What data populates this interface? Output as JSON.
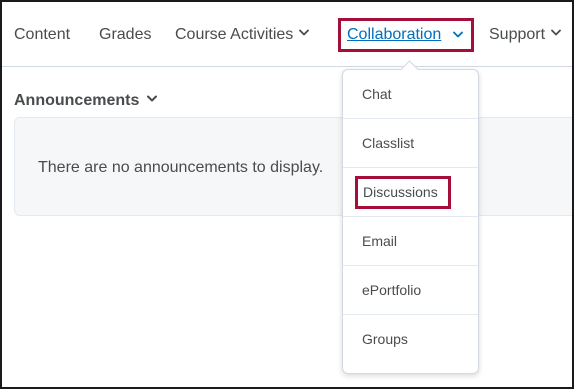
{
  "navbar": {
    "items": [
      {
        "label": "Content"
      },
      {
        "label": "Grades"
      },
      {
        "label": "Course Activities"
      },
      {
        "label": "Collaboration"
      },
      {
        "label": "Support"
      }
    ]
  },
  "widget": {
    "title": "Announcements",
    "message": "There are no announcements to display."
  },
  "dropdown": {
    "items": [
      {
        "label": "Chat"
      },
      {
        "label": "Classlist"
      },
      {
        "label": "Discussions"
      },
      {
        "label": "Email"
      },
      {
        "label": "ePortfolio"
      },
      {
        "label": "Groups"
      }
    ]
  },
  "colors": {
    "highlight": "#a50e38",
    "link": "#006fbf",
    "text": "#494c4e"
  },
  "icons": [
    "chevron-down-icon"
  ]
}
